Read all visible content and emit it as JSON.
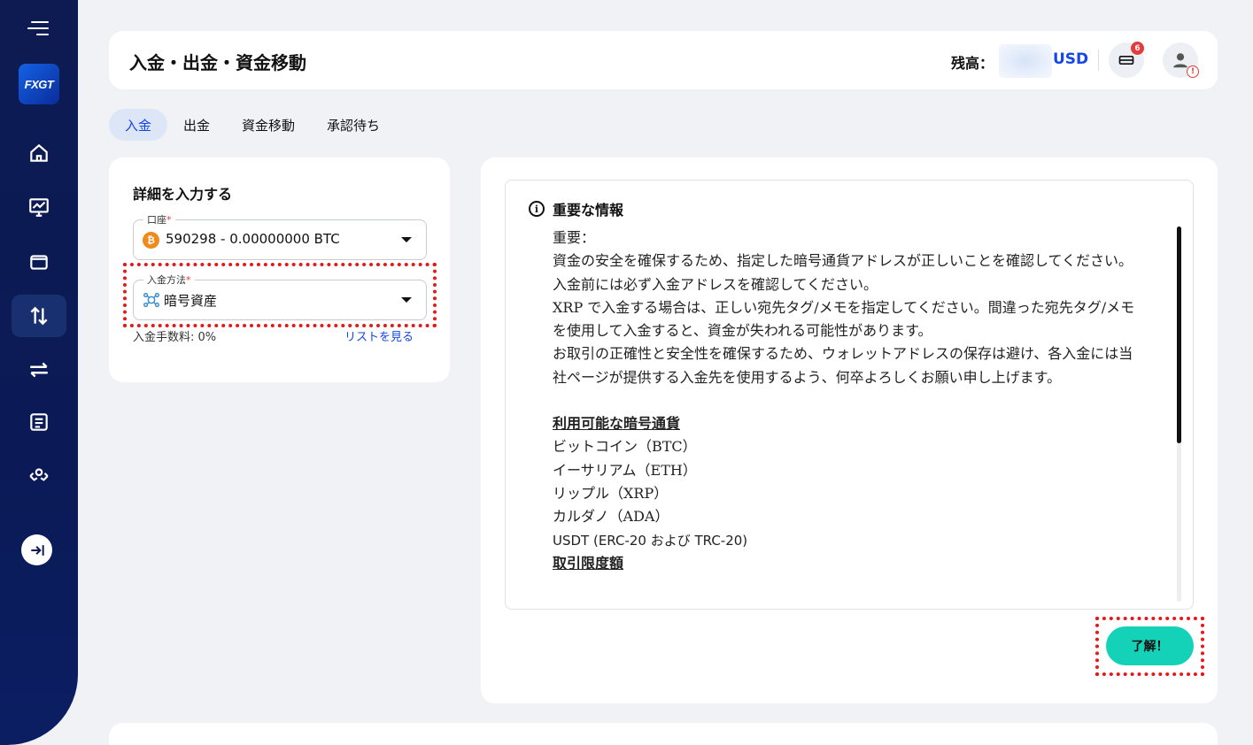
{
  "header": {
    "title": "入金・出金・資金移動",
    "balance_label": "残高：",
    "balance_currency": "USD",
    "notification_count": "6",
    "profile_warning": "!"
  },
  "sidebar": {
    "logo": "FXGT",
    "items": [
      {
        "icon": "home-icon"
      },
      {
        "icon": "chart-icon"
      },
      {
        "icon": "wallet-icon"
      },
      {
        "icon": "transfer-arrows-icon",
        "active": true
      },
      {
        "icon": "exchange-icon"
      },
      {
        "icon": "list-icon"
      },
      {
        "icon": "partner-icon"
      }
    ]
  },
  "tabs": [
    {
      "label": "入金",
      "active": true
    },
    {
      "label": "出金"
    },
    {
      "label": "資金移動"
    },
    {
      "label": "承認待ち"
    }
  ],
  "form": {
    "title": "詳細を入力する",
    "account_label": "口座",
    "account_value": "590298 - 0.00000000 BTC",
    "method_label": "入金方法",
    "method_value": "暗号資産",
    "fee_text": "入金手数料: 0%",
    "list_link": "リストを見る",
    "required_mark": "*"
  },
  "info": {
    "title": "重要な情報",
    "icon_glyph": "i",
    "lines": [
      "重要：",
      "資金の安全を確保するため、指定した暗号通貨アドレスが正しいことを確認してください。入金前には必ず入金アドレスを確認してください。",
      "XRP で入金する場合は、正しい宛先タグ/メモを指定してください。間違った宛先タグ/メモを使用して入金すると、資金が失われる可能性があります。",
      "お取引の正確性と安全性を確保するため、ウォレットアドレスの保存は避け、各入金には当社ページが提供する入金先を使用するよう、何卒よろしくお願い申し上げます。"
    ],
    "currencies_heading": "利用可能な暗号通貨",
    "currencies": [
      "ビットコイン（BTC）",
      "イーサリアム（ETH）",
      "リップル（XRP）",
      "カルダノ（ADA）",
      "USDT (ERC-20 および TRC-20)"
    ],
    "limits_heading": "取引限度額"
  },
  "ok_button": "了解！",
  "colors": {
    "accent": "#1546e8",
    "sidebar": "#0d1b52",
    "confirm": "#14d2b8",
    "highlight": "#e41a1a"
  }
}
